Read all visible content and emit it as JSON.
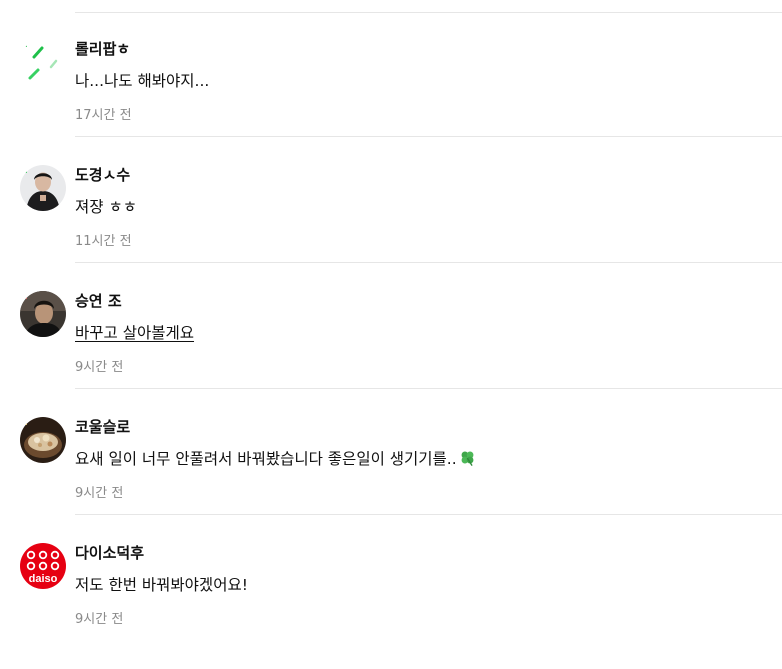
{
  "comments": [
    {
      "author": "롤리팝ㅎ",
      "text": "나...나도 해봐야지...",
      "time": "17시간 전",
      "avatar_icon": "green-loading-spinner-icon"
    },
    {
      "author": "도경ㅅ수",
      "text": "져쟝 ㅎㅎ",
      "time": "11시간 전",
      "avatar_icon": "person-photo-avatar"
    },
    {
      "author": "승연 조",
      "text": "바꾸고 살아볼게요",
      "time": "9시간 전",
      "avatar_icon": "person-photo-avatar"
    },
    {
      "author": "코울슬로",
      "text": "요새 일이 너무 안풀려서 바꿔봤습니다 좋은일이 생기기를..",
      "emoji": "four-leaf-clover-icon",
      "time": "9시간 전",
      "avatar_icon": "food-photo-avatar"
    },
    {
      "author": "다이소덕후",
      "text": "저도 한번 바꿔봐야겠어요!",
      "time": "9시간 전",
      "avatar_icon": "daiso-logo-avatar",
      "avatar_logo_text": "daiso"
    }
  ],
  "colors": {
    "divider": "#e6e6e6",
    "time": "#8a8a8a",
    "spinner_green": "#2fd15a",
    "daiso_red": "#e60012"
  }
}
